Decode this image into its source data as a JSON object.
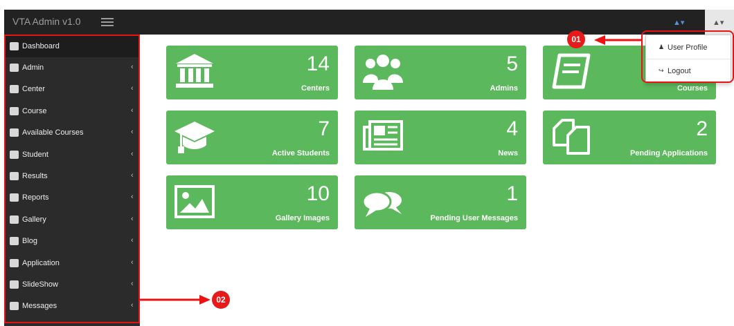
{
  "app": {
    "title": "VTA Admin v1.0"
  },
  "header": {
    "notifications_glyph": "▲▾",
    "user_glyph": "▲▾"
  },
  "sidebar": {
    "items": [
      {
        "label": "Dashboard",
        "icon": "dashboard-icon",
        "active": true,
        "has_chevron": false
      },
      {
        "label": "Admin",
        "icon": "users-icon",
        "has_chevron": true
      },
      {
        "label": "Center",
        "icon": "bank-icon",
        "has_chevron": true
      },
      {
        "label": "Course",
        "icon": "book-icon",
        "has_chevron": true
      },
      {
        "label": "Available Courses",
        "icon": "signpost-icon",
        "has_chevron": true
      },
      {
        "label": "Student",
        "icon": "graduation-cap-icon",
        "has_chevron": true
      },
      {
        "label": "Results",
        "icon": "registered-icon",
        "has_chevron": true
      },
      {
        "label": "Reports",
        "icon": "bar-chart-icon",
        "has_chevron": true
      },
      {
        "label": "Gallery",
        "icon": "image-icon",
        "has_chevron": true
      },
      {
        "label": "Blog",
        "icon": "newspaper-icon",
        "has_chevron": true
      },
      {
        "label": "Application",
        "icon": "copy-icon",
        "has_chevron": true
      },
      {
        "label": "SlideShow",
        "icon": "picture-icon",
        "has_chevron": true
      },
      {
        "label": "Messages",
        "icon": "comments-icon",
        "has_chevron": true
      }
    ],
    "chevron": "‹"
  },
  "tiles": [
    {
      "value": "14",
      "label": "Centers",
      "icon": "bank-icon"
    },
    {
      "value": "5",
      "label": "Admins",
      "icon": "users-icon"
    },
    {
      "value": "",
      "label": "Courses",
      "icon": "book-icon"
    },
    {
      "value": "7",
      "label": "Active Students",
      "icon": "graduation-cap-icon"
    },
    {
      "value": "4",
      "label": "News",
      "icon": "newspaper-icon"
    },
    {
      "value": "2",
      "label": "Pending Applications",
      "icon": "copy-icon"
    },
    {
      "value": "10",
      "label": "Gallery Images",
      "icon": "image-icon"
    },
    {
      "value": "1",
      "label": "Pending User Messages",
      "icon": "comments-icon"
    }
  ],
  "user_menu": {
    "items": [
      {
        "label": "User Profile",
        "glyph": "♟",
        "icon": "user-icon"
      },
      {
        "label": "Logout",
        "glyph": "↪",
        "icon": "sign-out-icon"
      }
    ]
  },
  "callouts": {
    "one": "01",
    "two": "02"
  },
  "colors": {
    "navbar": "#222222",
    "sidebar": "#2b2b2b",
    "tile": "#5cb85c",
    "callout": "#e61a1a",
    "highlight": "#ee1111"
  }
}
